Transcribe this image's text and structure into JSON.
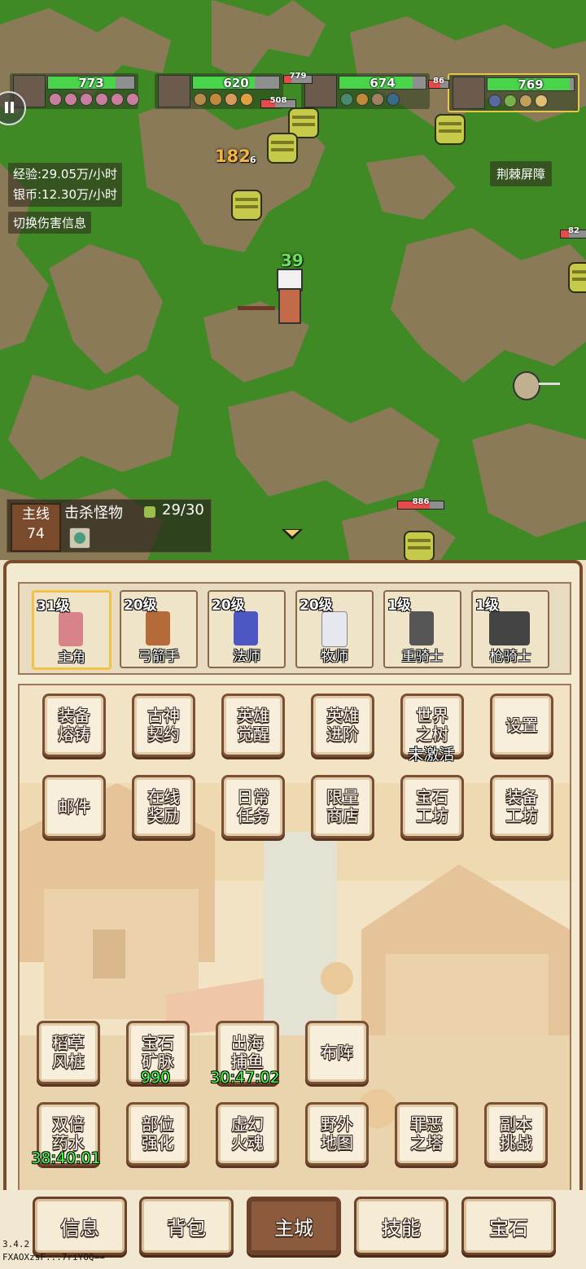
{
  "hud": {
    "party": [
      {
        "name": "hero-1",
        "hp": 773,
        "hp_fraction": 0.78
      },
      {
        "name": "hero-2",
        "hp": 620,
        "hp_fraction": 0.72
      },
      {
        "name": "hero-3",
        "hp": 674,
        "hp_fraction": 0.85
      },
      {
        "name": "hero-4",
        "hp": 769,
        "hp_fraction": 0.95
      }
    ],
    "exp_rate": "经验:29.05万/小时",
    "silver_rate": "银币:12.30万/小时",
    "toggle_damage": "切换伤害信息",
    "status_effect": "荆棘屏障"
  },
  "battle": {
    "damage_numbers": [
      "182",
      "6",
      "39"
    ],
    "enemy_hp": [
      "779",
      "508",
      "86",
      "82",
      "886"
    ]
  },
  "quest": {
    "chapter_label": "主线",
    "chapter_number": "74",
    "title": "击杀怪物",
    "progress": "29/30"
  },
  "heroes": [
    {
      "level": "31级",
      "name": "主角",
      "selected": true,
      "color": "#d8828a"
    },
    {
      "level": "20级",
      "name": "弓箭手",
      "selected": false,
      "color": "#b56a3a"
    },
    {
      "level": "20级",
      "name": "法师",
      "selected": false,
      "color": "#4b56c2"
    },
    {
      "level": "20级",
      "name": "牧师",
      "selected": false,
      "color": "#e7e7f0"
    },
    {
      "level": "1级",
      "name": "重骑士",
      "selected": false,
      "color": "#555555"
    },
    {
      "level": "1级",
      "name": "枪骑士",
      "selected": false,
      "color": "#444444"
    }
  ],
  "menu_row1": [
    {
      "label": "装备\n熔铸"
    },
    {
      "label": "古神\n契约"
    },
    {
      "label": "英雄\n觉醒"
    },
    {
      "label": "英雄\n进阶"
    },
    {
      "label": "世界\n之树",
      "sub": "未激活"
    },
    {
      "label": "设置"
    }
  ],
  "menu_row2": [
    {
      "label": "邮件"
    },
    {
      "label": "在线\n奖励"
    },
    {
      "label": "日常\n任务"
    },
    {
      "label": "限量\n商店"
    },
    {
      "label": "宝石\n工坊"
    },
    {
      "label": "装备\n工坊"
    }
  ],
  "menu_row3": [
    {
      "label": "稻草\n风桩"
    },
    {
      "label": "宝石\n矿脉",
      "sub": "990"
    },
    {
      "label": "出海\n捕鱼",
      "sub": "30:47:02"
    },
    {
      "label": "布阵"
    }
  ],
  "menu_row4": [
    {
      "label": "双倍\n药水",
      "sub": "38:40:01"
    },
    {
      "label": "部位\n强化"
    },
    {
      "label": "虚幻\n火魂"
    },
    {
      "label": "野外\n地图"
    },
    {
      "label": "罪恶\n之塔"
    },
    {
      "label": "副本\n挑战"
    }
  ],
  "tabs": [
    {
      "label": "信息",
      "active": false
    },
    {
      "label": "背包",
      "active": false
    },
    {
      "label": "主城",
      "active": true
    },
    {
      "label": "技能",
      "active": false
    },
    {
      "label": "宝石",
      "active": false
    }
  ],
  "footer": {
    "version": "3.4.2",
    "device_id": "FXAOXzsF...7riYOQ=="
  }
}
